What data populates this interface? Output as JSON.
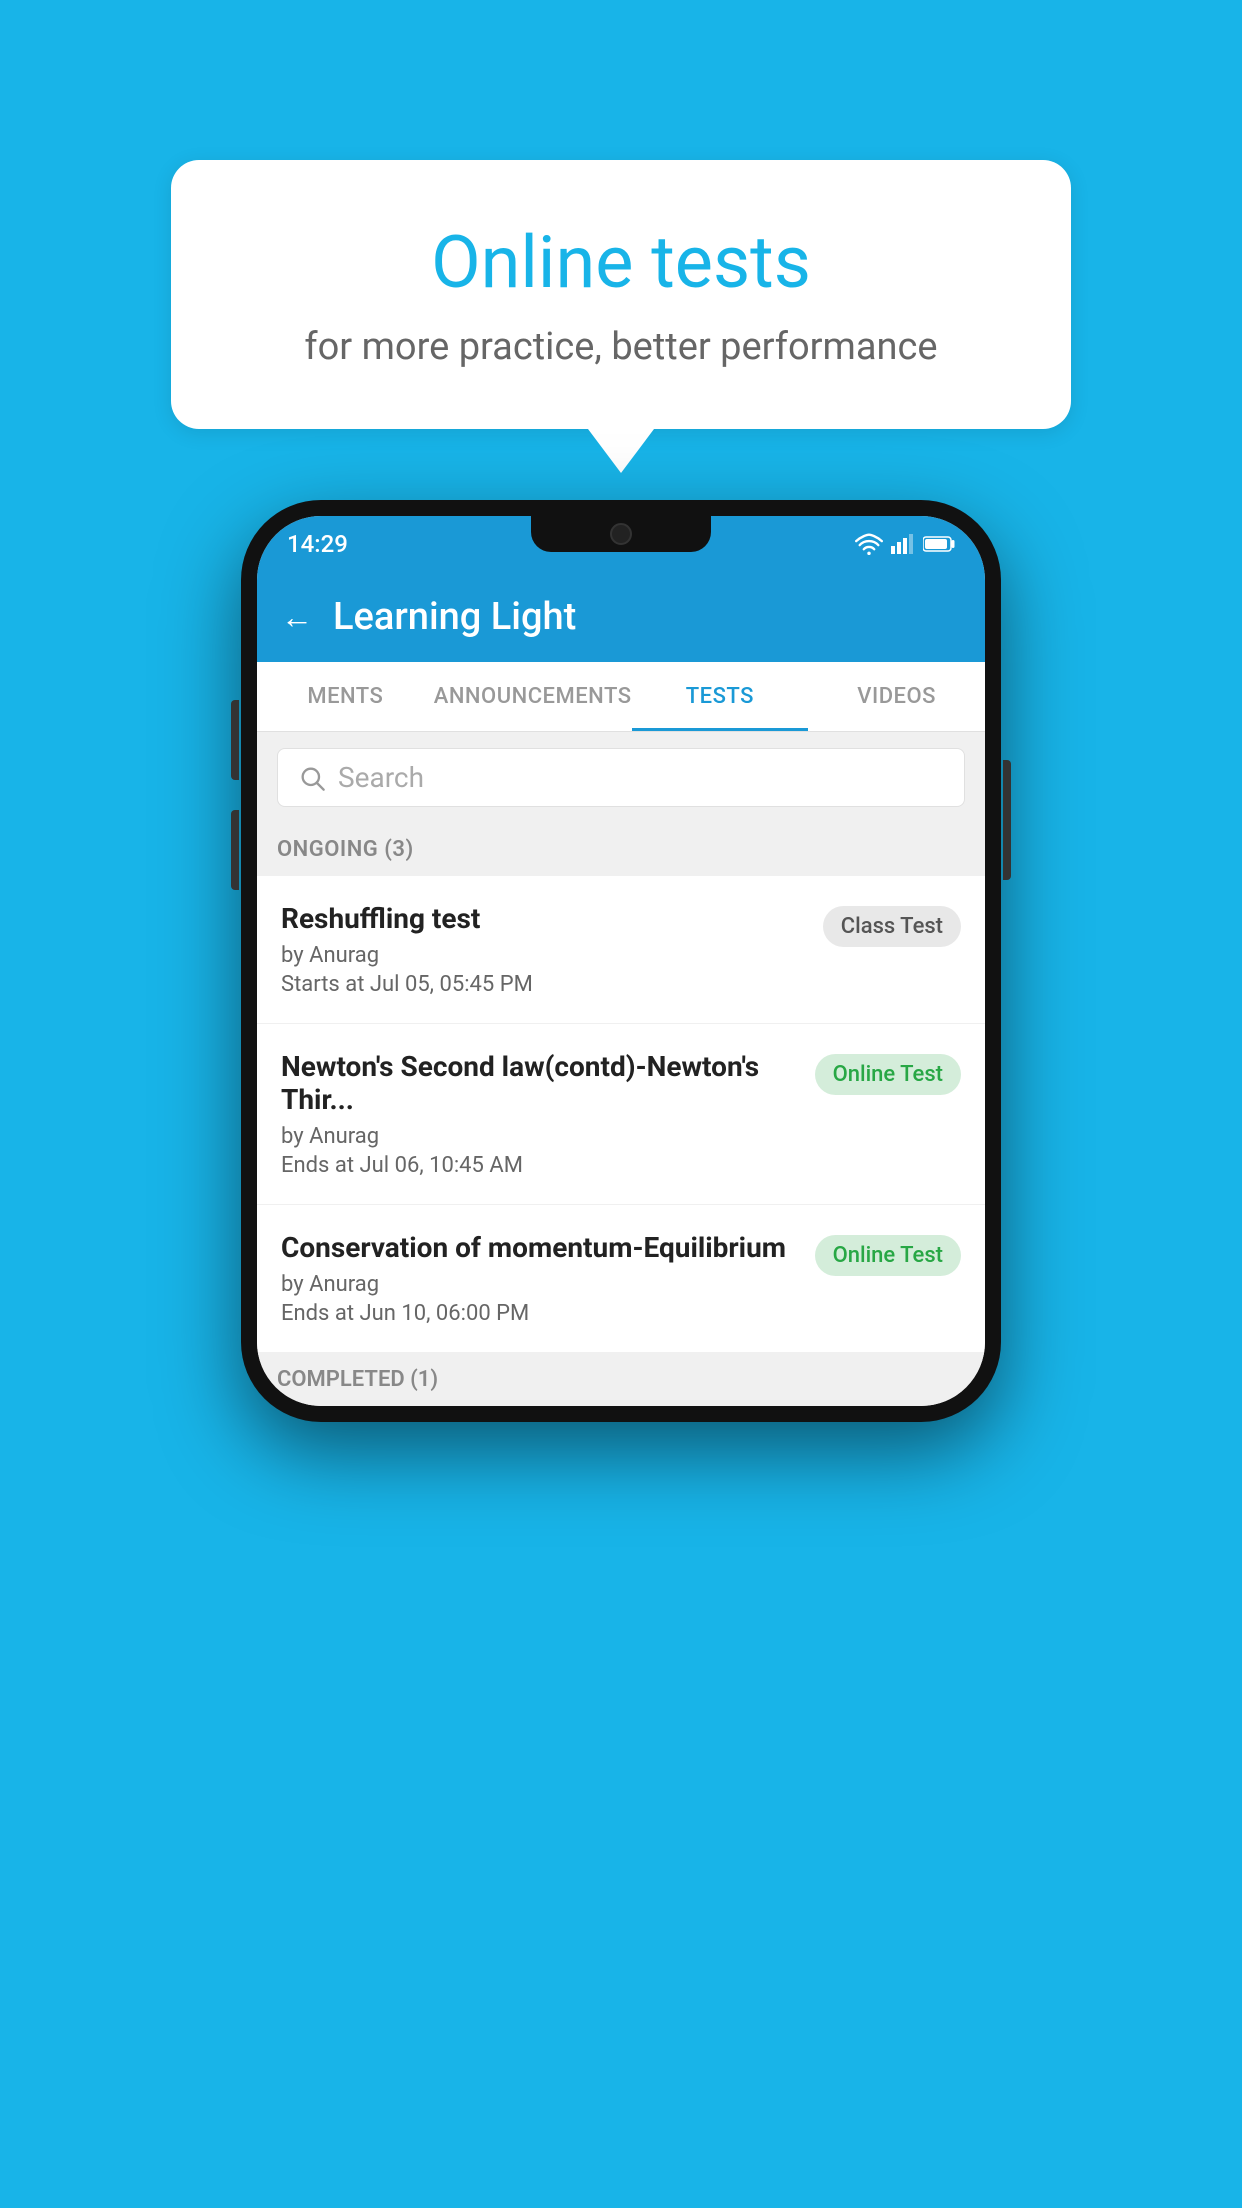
{
  "background_color": "#18b4e8",
  "bubble": {
    "title": "Online tests",
    "subtitle": "for more practice, better performance"
  },
  "phone": {
    "status_bar": {
      "time": "14:29",
      "icons": [
        "wifi",
        "signal",
        "battery"
      ]
    },
    "header": {
      "title": "Learning Light",
      "back_label": "←"
    },
    "tabs": [
      {
        "label": "MENTS",
        "active": false
      },
      {
        "label": "ANNOUNCEMENTS",
        "active": false
      },
      {
        "label": "TESTS",
        "active": true
      },
      {
        "label": "VIDEOS",
        "active": false
      }
    ],
    "search": {
      "placeholder": "Search"
    },
    "sections": [
      {
        "label": "ONGOING (3)",
        "items": [
          {
            "name": "Reshuffling test",
            "author": "by Anurag",
            "time_label": "Starts at",
            "time": "Jul 05, 05:45 PM",
            "badge": "Class Test",
            "badge_type": "class"
          },
          {
            "name": "Newton's Second law(contd)-Newton's Thir...",
            "author": "by Anurag",
            "time_label": "Ends at",
            "time": "Jul 06, 10:45 AM",
            "badge": "Online Test",
            "badge_type": "online"
          },
          {
            "name": "Conservation of momentum-Equilibrium",
            "author": "by Anurag",
            "time_label": "Ends at",
            "time": "Jun 10, 06:00 PM",
            "badge": "Online Test",
            "badge_type": "online"
          }
        ]
      }
    ],
    "completed_label": "COMPLETED (1)"
  }
}
